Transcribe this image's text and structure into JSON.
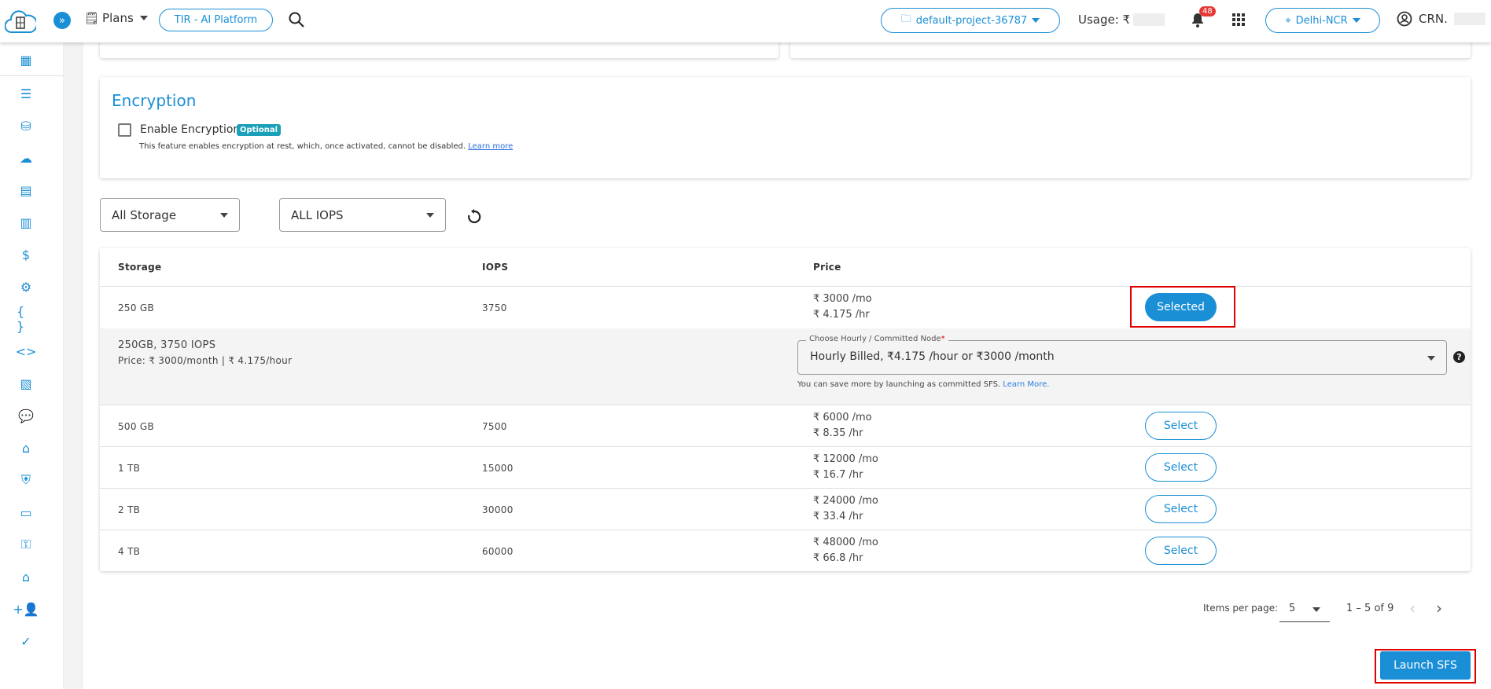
{
  "header": {
    "plans": "Plans",
    "platform": "TIR - AI Platform",
    "project": "default-project-36787",
    "usage": "Usage: ₹",
    "notifications": "48",
    "region": "Delhi-NCR",
    "crn": "CRN."
  },
  "encryption": {
    "title": "Encryption",
    "checkbox_label": "Enable Encryption",
    "badge": "Optional",
    "description": "This feature enables encryption at rest, which, once activated, cannot be disabled.",
    "learn_more": "Learn more"
  },
  "filters": {
    "storage": "All Storage",
    "iops": "ALL IOPS"
  },
  "table": {
    "headers": [
      "Storage",
      "IOPS",
      "Price"
    ],
    "rows": [
      {
        "storage": "250 GB",
        "iops": "3750",
        "mo": "₹ 3000 /mo",
        "hr": "₹ 4.175 /hr",
        "action": "Selected"
      },
      {
        "storage": "500 GB",
        "iops": "7500",
        "mo": "₹ 6000 /mo",
        "hr": "₹ 8.35 /hr",
        "action": "Select"
      },
      {
        "storage": "1 TB",
        "iops": "15000",
        "mo": "₹ 12000 /mo",
        "hr": "₹ 16.7 /hr",
        "action": "Select"
      },
      {
        "storage": "2 TB",
        "iops": "30000",
        "mo": "₹ 24000 /mo",
        "hr": "₹ 33.4 /hr",
        "action": "Select"
      },
      {
        "storage": "4 TB",
        "iops": "60000",
        "mo": "₹ 48000 /mo",
        "hr": "₹ 66.8 /hr",
        "action": "Select"
      }
    ],
    "detail": {
      "summary": "250GB, 3750 IOPS",
      "price": "Price: ₹ 3000/month | ₹ 4.175/hour",
      "field_label": "Choose Hourly / Committed Node",
      "required": "*",
      "field_value": "Hourly Billed, ₹4.175 /hour or ₹3000 /month",
      "hint": "You can save more by launching as committed SFS.",
      "hint_link": "Learn More."
    }
  },
  "pagination": {
    "label": "Items per page:",
    "size": "5",
    "range": "1 – 5 of 9"
  },
  "launch": "Launch SFS",
  "colors": {
    "accent": "#1a8fd6",
    "highlight": "#e00000"
  }
}
